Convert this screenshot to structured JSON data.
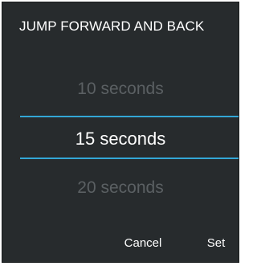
{
  "dialog": {
    "title": "JUMP FORWARD AND BACK",
    "picker": {
      "previous": "10 seconds",
      "selected": "15 seconds",
      "next": "20 seconds"
    },
    "buttons": {
      "cancel": "Cancel",
      "set": "Set"
    }
  },
  "colors": {
    "background": "#272b2d",
    "accent": "#33a7d6",
    "text": "#ffffff",
    "dim_text": "#5b6063"
  }
}
